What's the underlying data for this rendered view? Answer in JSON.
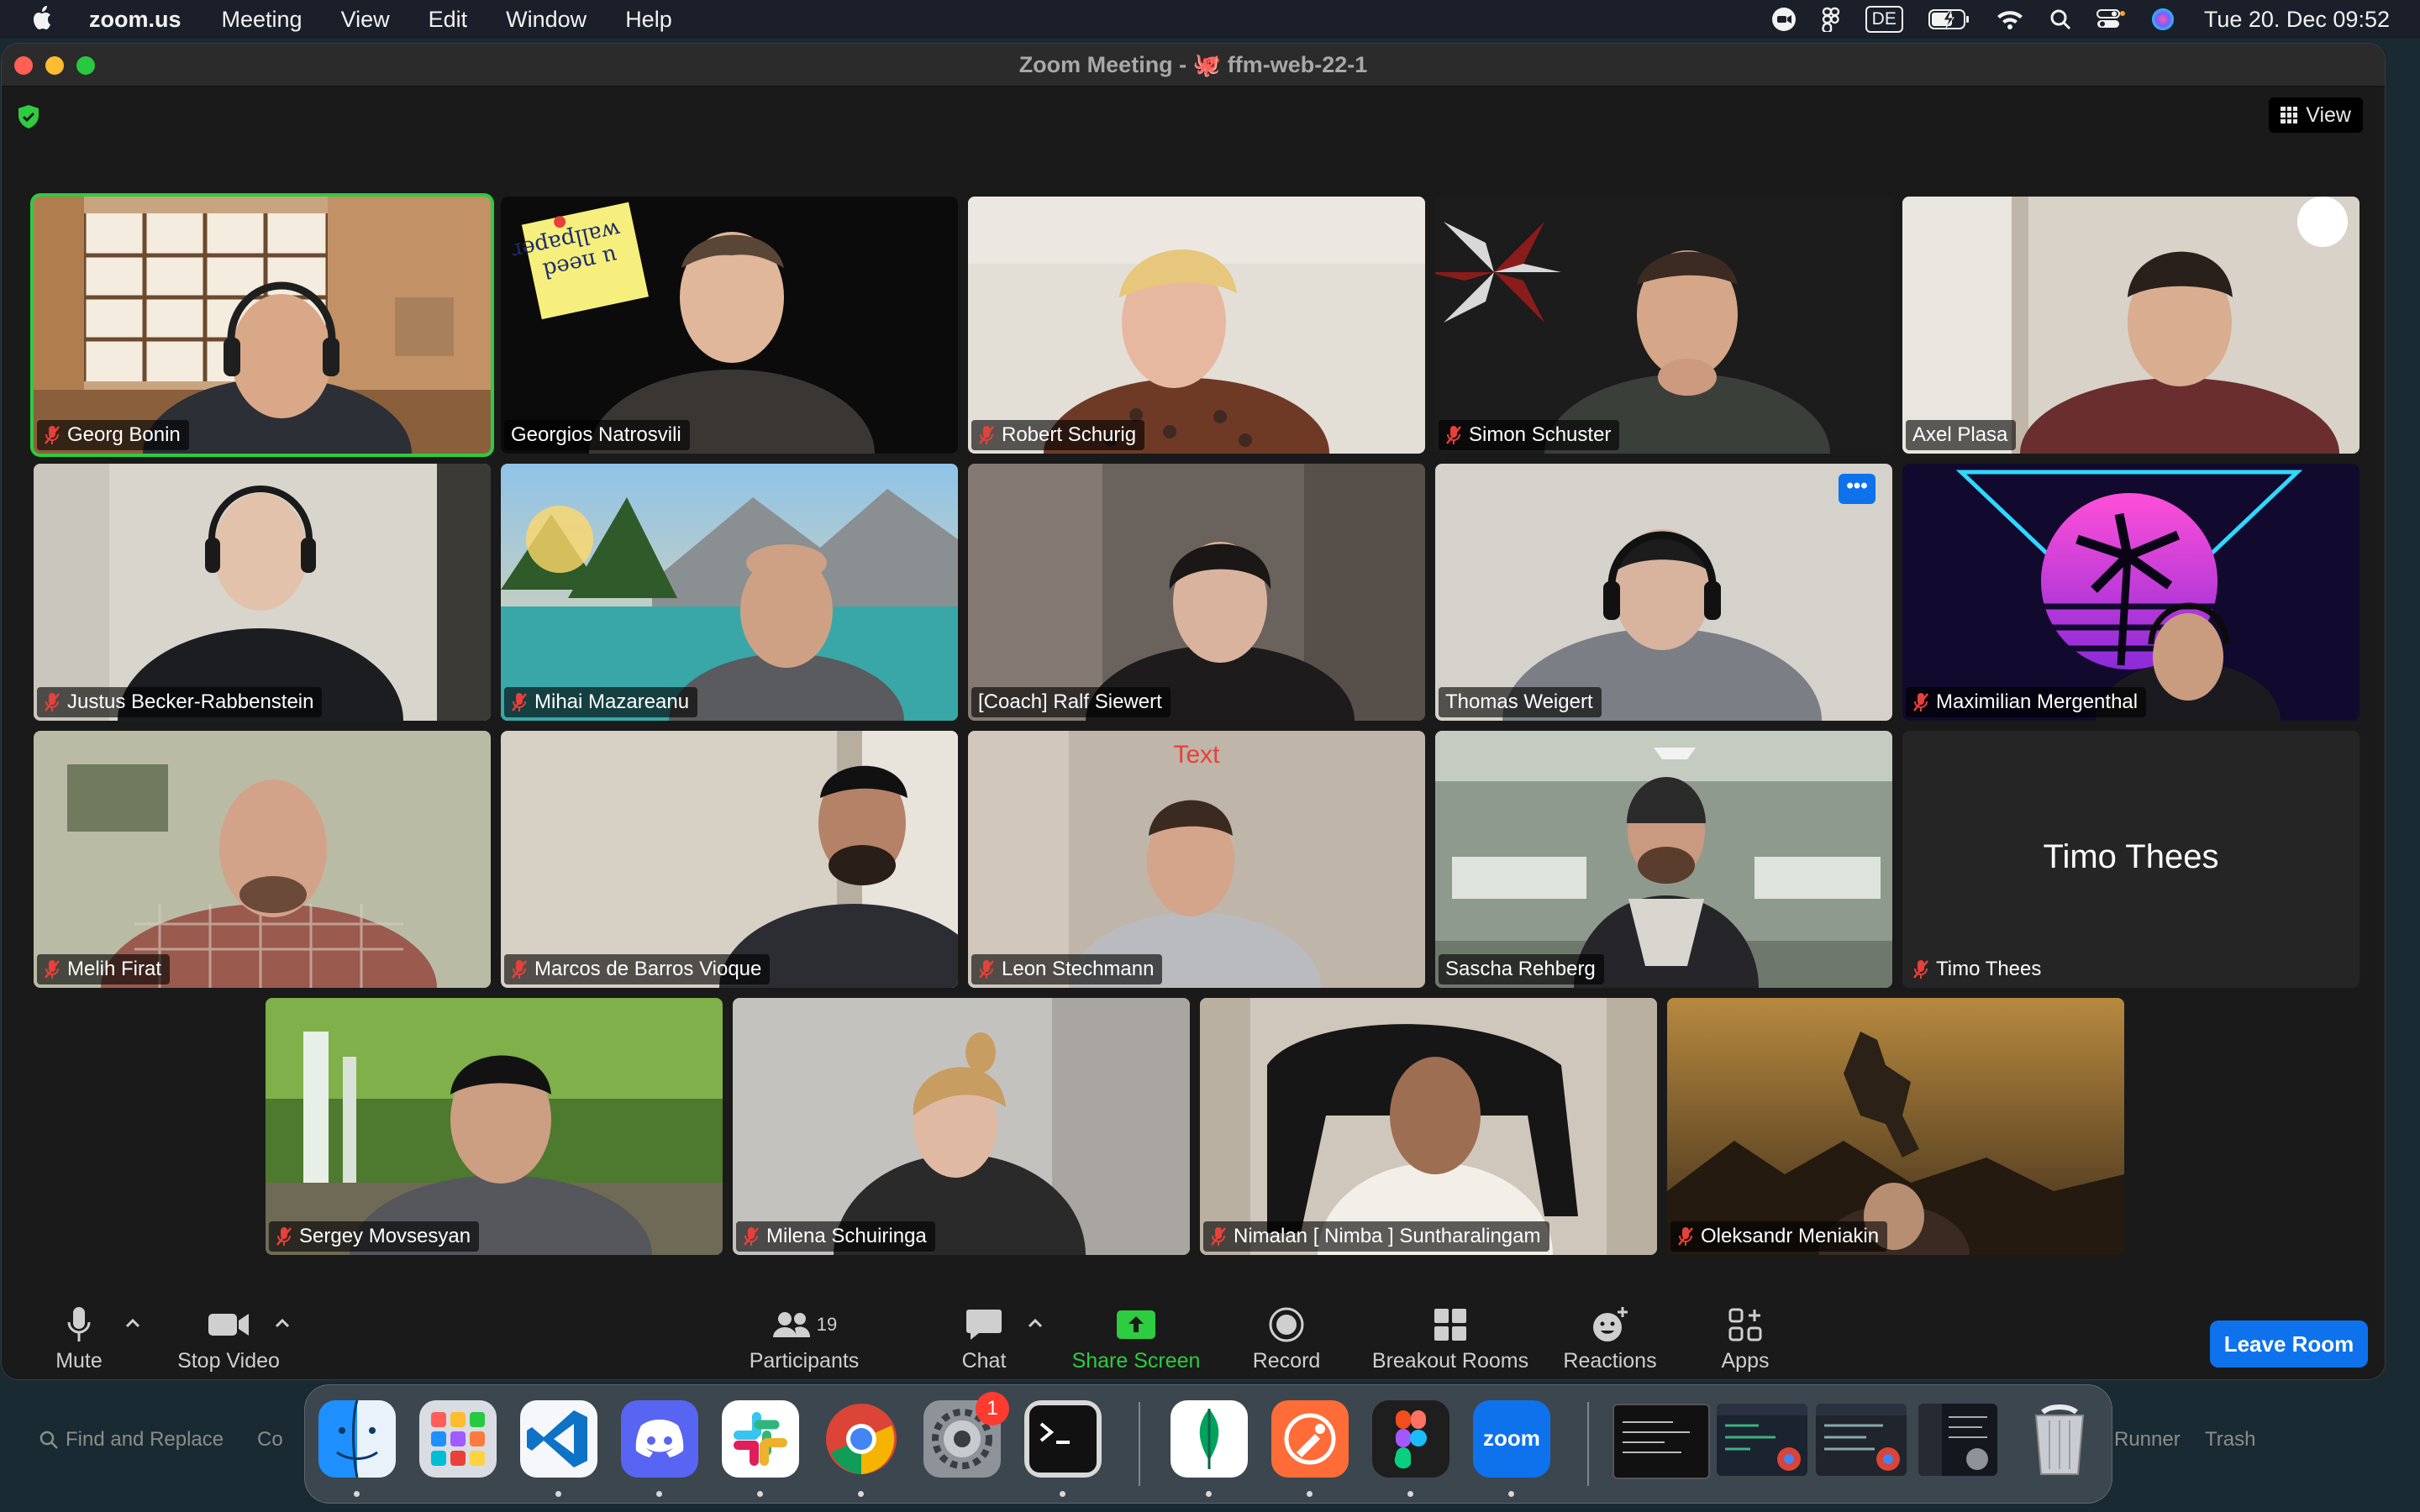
{
  "menubar": {
    "app_name": "zoom.us",
    "menus": [
      "Meeting",
      "View",
      "Edit",
      "Window",
      "Help"
    ],
    "input_language": "DE",
    "clock": "Tue 20. Dec  09:52"
  },
  "window": {
    "title": "Zoom Meeting - 🐙 ffm-web-22-1",
    "view_label": "View"
  },
  "participants": [
    {
      "name": "Georg Bonin",
      "muted": true,
      "speaking": true
    },
    {
      "name": "Georgios Natrosvili",
      "muted": false,
      "sticky_note": "u need wallpaper"
    },
    {
      "name": "Robert Schurig",
      "muted": true
    },
    {
      "name": "Simon Schuster",
      "muted": true
    },
    {
      "name": "Axel Plasa",
      "muted": false
    },
    {
      "name": "Justus Becker-Rabbenstein",
      "muted": true
    },
    {
      "name": "Mihai Mazareanu",
      "muted": true
    },
    {
      "name": "[Coach] Ralf Siewert",
      "muted": false
    },
    {
      "name": "Thomas Weigert",
      "muted": false,
      "more_button": "•••"
    },
    {
      "name": "Maximilian Mergenthal",
      "muted": true
    },
    {
      "name": "Melih Firat",
      "muted": true
    },
    {
      "name": "Marcos de Barros Vioque",
      "muted": true
    },
    {
      "name": "Leon Stechmann",
      "muted": true,
      "overlay_text": "Text"
    },
    {
      "name": "Sascha Rehberg",
      "muted": false
    },
    {
      "name": "Timo Thees",
      "muted": true,
      "video_off": true
    },
    {
      "name": "Sergey Movsesyan",
      "muted": true
    },
    {
      "name": "Milena Schuiringa",
      "muted": true
    },
    {
      "name": "Nimalan [ Nimba ] Suntharalingam",
      "muted": true
    },
    {
      "name": "Oleksandr Meniakin",
      "muted": true
    }
  ],
  "toolbar": {
    "mute": "Mute",
    "stop_video": "Stop Video",
    "participants": "Participants",
    "participants_count": "19",
    "chat": "Chat",
    "share_screen": "Share Screen",
    "record": "Record",
    "breakout_rooms": "Breakout Rooms",
    "reactions": "Reactions",
    "apps": "Apps",
    "leave": "Leave Room"
  },
  "background_strip": {
    "find_replace": "Find and Replace",
    "left_cut": "Co",
    "runner": "Runner",
    "trash": "Trash"
  },
  "dock": {
    "apps": [
      "finder",
      "launchpad",
      "vscode",
      "discord",
      "slack",
      "chrome",
      "system-settings",
      "terminal",
      "mongodb-compass",
      "postman",
      "figma",
      "zoom"
    ],
    "settings_badge": "1",
    "zoom_label": "zoom"
  },
  "colors": {
    "accent_blue": "#0e72ed",
    "speaking_green": "#2ecc40",
    "mute_red": "#e8403a",
    "toolbar_bg": "#1a1a1a"
  }
}
